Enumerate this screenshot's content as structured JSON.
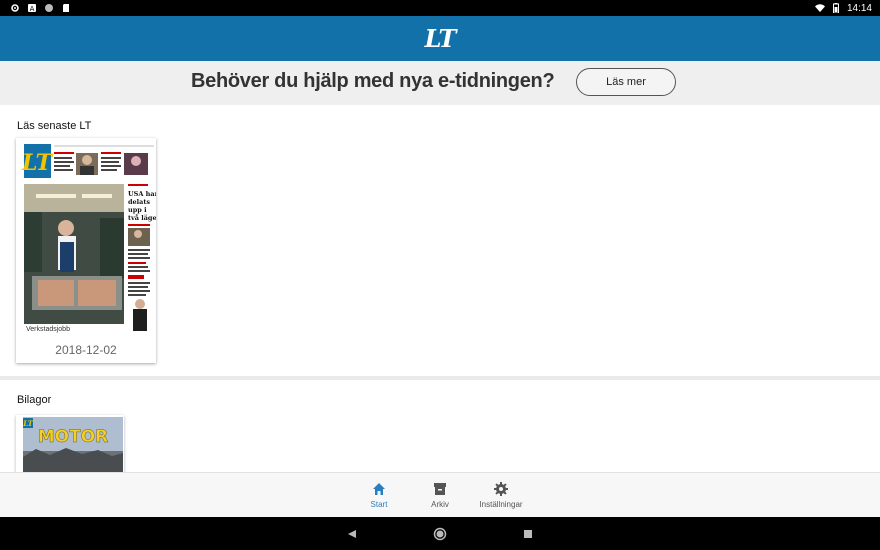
{
  "status_bar": {
    "time": "14:14"
  },
  "app": {
    "logo": "LT"
  },
  "banner": {
    "text": "Behöver du hjälp med nya e-tidningen?",
    "button": "Läs mer"
  },
  "latest": {
    "section_title": "Läs senaste LT",
    "date": "2018-12-02",
    "cover": {
      "logo": "LT",
      "headline": "USA har delats upp i två läger",
      "caption": "Verkstadsjobb"
    }
  },
  "bilagor": {
    "section_title": "Bilagor",
    "cover_logo": "LT",
    "cover_title": "MOTOR"
  },
  "bottom_nav": {
    "items": [
      {
        "label": "Start",
        "icon": "home-icon",
        "active": true
      },
      {
        "label": "Arkiv",
        "icon": "archive-icon",
        "active": false
      },
      {
        "label": "Inställningar",
        "icon": "gear-icon",
        "active": false
      }
    ]
  },
  "colors": {
    "brand": "#1171a8",
    "active_nav": "#2a7fc1",
    "banner_bg": "#efefef"
  }
}
